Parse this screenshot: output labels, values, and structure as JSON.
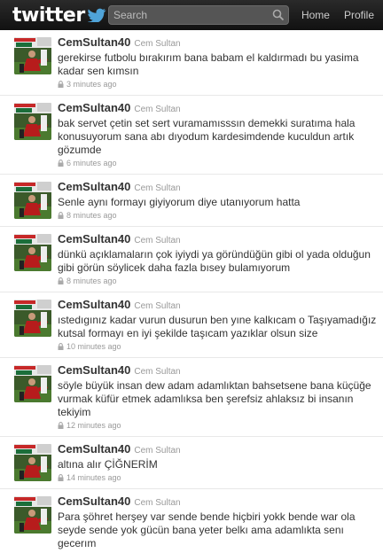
{
  "header": {
    "logo": "twitter",
    "search_placeholder": "Search",
    "nav": {
      "home": "Home",
      "profile": "Profile"
    }
  },
  "tweets": [
    {
      "username": "CemSultan40",
      "realname": "Cem Sultan",
      "text": "gerekirse futbolu bırakırım bana babam el kaldırmadı bu yasima kadar sen kımsın",
      "time": "3 minutes ago"
    },
    {
      "username": "CemSultan40",
      "realname": "Cem Sultan",
      "text": "bak servet çetin set sert vuramamısssın demekki suratıma hala konusuyorum sana abı dıyodum kardesimdende kuculdun artık gözumde",
      "time": "6 minutes ago"
    },
    {
      "username": "CemSultan40",
      "realname": "Cem Sultan",
      "text": "Senle aynı formayı giyiyorum diye utanıyorum hatta",
      "time": "8 minutes ago"
    },
    {
      "username": "CemSultan40",
      "realname": "Cem Sultan",
      "text": "dünkü açıklamaların çok iyiydi ya göründüğün gibi ol yada olduğun gibi görün söylicek daha fazla bısey bulamıyorum",
      "time": "8 minutes ago"
    },
    {
      "username": "CemSultan40",
      "realname": "Cem Sultan",
      "text": "ıstedıgınız kadar vurun dusurun ben yıne kalkıcam o Taşıyamadığız kutsal formayı en iyi şekilde taşıcam yazıklar olsun size",
      "time": "10 minutes ago"
    },
    {
      "username": "CemSultan40",
      "realname": "Cem Sultan",
      "text": "söyle büyük insan dew adam adamlıktan bahsetsene bana küçüğe vurmak küfür etmek adamlıksa ben şerefsiz ahlaksız bi insanın tekiyim",
      "time": "12 minutes ago"
    },
    {
      "username": "CemSultan40",
      "realname": "Cem Sultan",
      "text": "altına alır ÇİĞNERİM",
      "time": "14 minutes ago"
    },
    {
      "username": "CemSultan40",
      "realname": "Cem Sultan",
      "text": "Para şöhret herşey var sende bende hiçbiri yokk bende war ola seyde sende yok gücün bana yeter belkı ama adamlıkta senı gecerım",
      "time": ""
    }
  ],
  "colors": {
    "topbar": "#1a1a1a",
    "background": "#c0deed",
    "accent": "#4fa3d8"
  }
}
